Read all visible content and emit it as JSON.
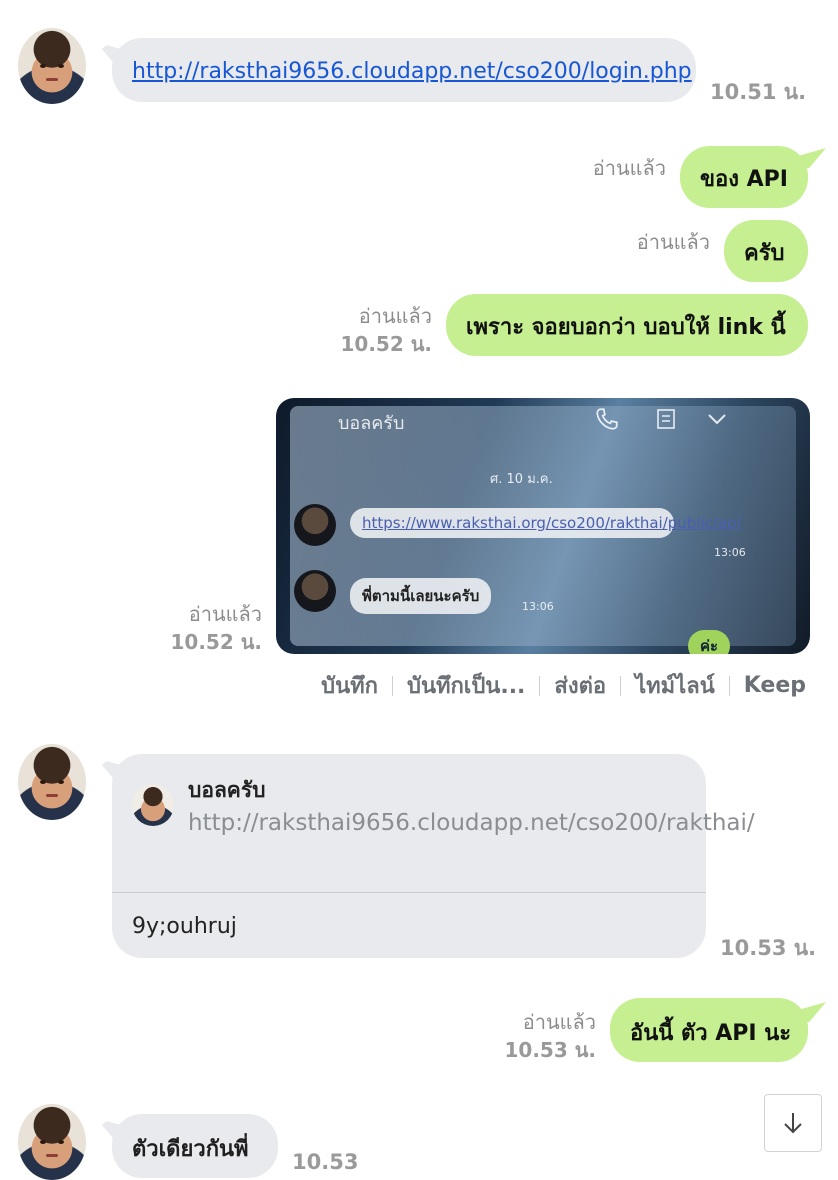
{
  "messages": {
    "m1": {
      "link": "http://raksthai9656.cloudapp.net/cso200/login.php",
      "time": "10.51 น."
    },
    "m2": {
      "text": "ของ API",
      "status": "อ่านแล้ว"
    },
    "m3": {
      "text": "ครับ",
      "status": "อ่านแล้ว"
    },
    "m4": {
      "text": "เพราะ จอยบอกว่า บอบให้ link นี้",
      "status": "อ่านแล้ว",
      "time": "10.52 น."
    },
    "m5": {
      "status": "อ่านแล้ว",
      "time": "10.52 น.",
      "photo": {
        "header": "บอลครับ",
        "date": "ศ. 10 ม.ค.",
        "link": "https://www.raksthai.org/cso200/rakthai/public/api",
        "link_time": "13:06",
        "msg": "พี่ตามนี้เลยนะครับ",
        "msg_time": "13:06",
        "reply": "ค่ะ"
      }
    },
    "m6": {
      "quote_name": "บอลครับ",
      "quote_link": "http://raksthai9656.cloudapp.net/cso200/rakthai/",
      "reply": "9y;ouhruj",
      "time": "10.53 น."
    },
    "m7": {
      "text": "อันนี้ ตัว API นะ",
      "status": "อ่านแล้ว",
      "time": "10.53 น."
    },
    "m8": {
      "text": "ตัวเดียวกันพี่",
      "time": "10.53"
    }
  },
  "image_actions": [
    "บันทึก",
    "บันทึกเป็น...",
    "ส่งต่อ",
    "ไทม์ไลน์",
    "Keep"
  ],
  "colors": {
    "sent_bubble": "#c5ef91",
    "received_bubble": "#e8eaed",
    "link": "#1757d6"
  },
  "icons": {
    "scroll": "arrow-down-icon",
    "call": "phone-icon",
    "menu": "menu-icon"
  }
}
